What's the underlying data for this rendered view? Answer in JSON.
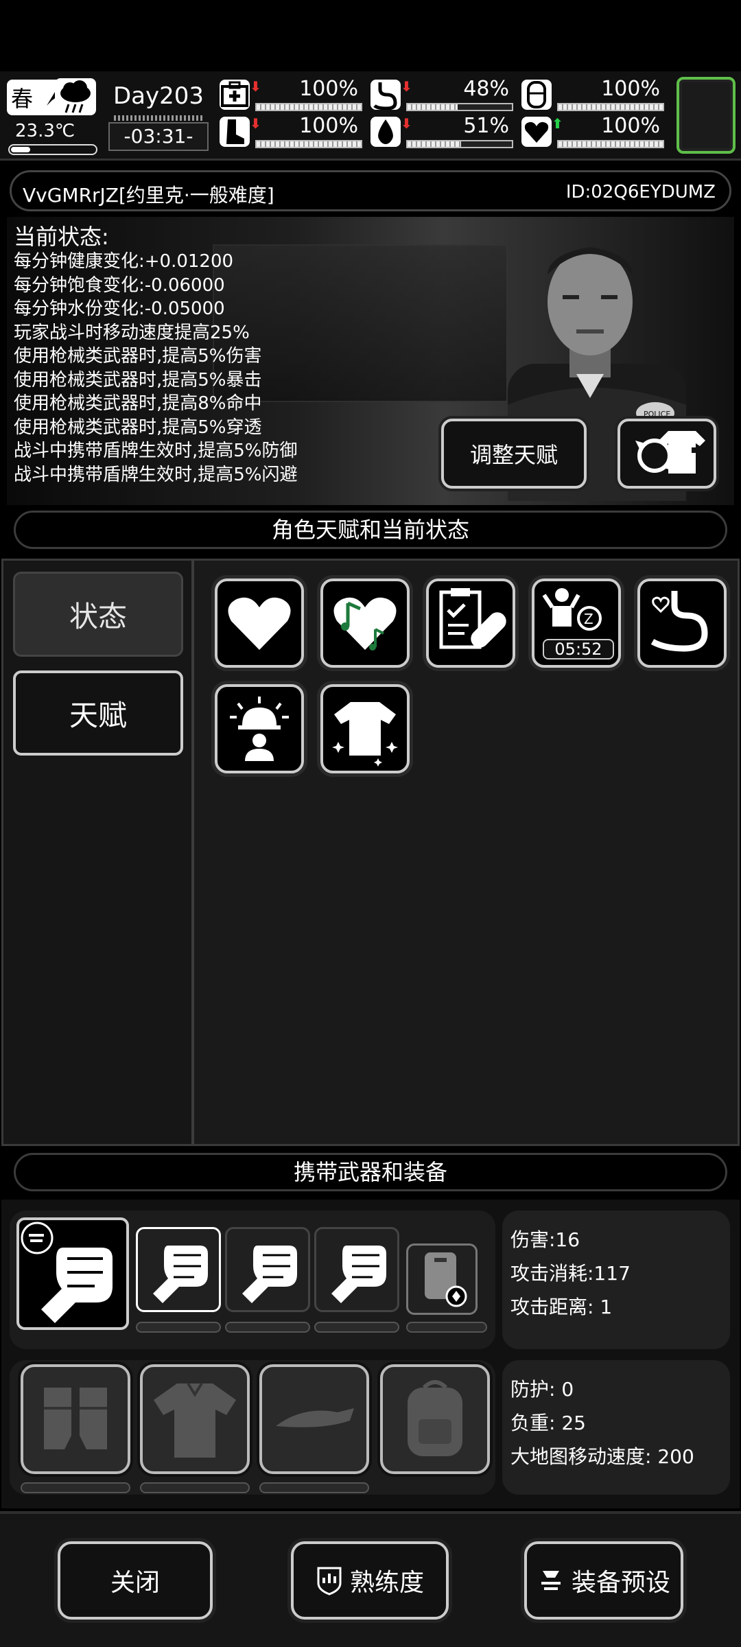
{
  "topbar": {
    "season": "春",
    "temperature": "23.3℃",
    "day": "Day203",
    "time": "-03:31-",
    "stats": [
      {
        "name": "medical",
        "icon": "medkit-icon",
        "trend": "down",
        "value": "100%",
        "fill": 1.0
      },
      {
        "name": "hunger",
        "icon": "stomach-icon",
        "trend": "down",
        "value": "48%",
        "fill": 0.48
      },
      {
        "name": "armor",
        "icon": "shield-icon",
        "trend": "",
        "value": "100%",
        "fill": 1.0
      },
      {
        "name": "stamina",
        "icon": "boot-icon",
        "trend": "down",
        "value": "100%",
        "fill": 1.0
      },
      {
        "name": "thirst",
        "icon": "water-drop-icon",
        "trend": "down",
        "value": "51%",
        "fill": 0.51
      },
      {
        "name": "mood",
        "icon": "heart-icon",
        "trend": "up",
        "value": "100%",
        "fill": 1.0
      }
    ]
  },
  "player": {
    "name": "VvGMRrJZ[约里克·一般难度]",
    "id": "ID:02Q6EYDUMZ"
  },
  "status": {
    "title": "当前状态:",
    "lines": [
      "每分钟健康变化:+0.01200",
      "每分钟饱食变化:-0.06000",
      "每分钟水份变化:-0.05000",
      "玩家战斗时移动速度提高25%",
      "使用枪械类武器时,提高5%伤害",
      "使用枪械类武器时,提高5%暴击",
      "使用枪械类武器时,提高8%命中",
      "使用枪械类武器时,提高5%穿透",
      "战斗中携带盾牌生效时,提高5%防御",
      "战斗中携带盾牌生效时,提高5%闪避"
    ],
    "adjust_talent_button": "调整天赋"
  },
  "talents_section": {
    "title": "角色天赋和当前状态",
    "tabs": [
      "状态",
      "天赋"
    ],
    "timer": "05:52"
  },
  "equipment_section": {
    "title": "携带武器和装备",
    "weapon_stats": [
      "伤害:16",
      "攻击消耗:117",
      "攻击距离: 1"
    ],
    "armor_stats": [
      "防护: 0",
      "负重: 25",
      "大地图移动速度: 200"
    ]
  },
  "bottom": {
    "close": "关闭",
    "proficiency": "熟练度",
    "equip_preset": "装备预设"
  },
  "colors": {
    "accent_green": "#5fbf4a",
    "down_arrow": "#e53030",
    "up_arrow": "#26d04a"
  }
}
